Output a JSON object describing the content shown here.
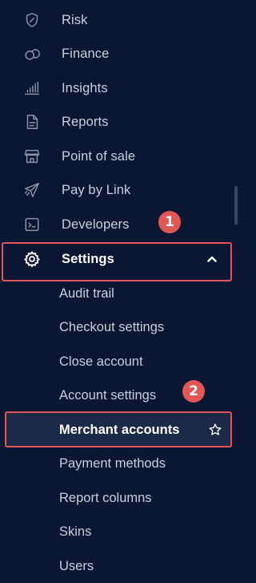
{
  "nav": {
    "items": [
      {
        "label": "Risk",
        "icon": "shield-icon"
      },
      {
        "label": "Finance",
        "icon": "coins-icon"
      },
      {
        "label": "Insights",
        "icon": "bar-chart-icon"
      },
      {
        "label": "Reports",
        "icon": "document-icon"
      },
      {
        "label": "Point of sale",
        "icon": "store-icon"
      },
      {
        "label": "Pay by Link",
        "icon": "paper-plane-icon"
      },
      {
        "label": "Developers",
        "icon": "terminal-icon"
      },
      {
        "label": "Settings",
        "icon": "gear-icon",
        "active": true,
        "expanded": true
      }
    ],
    "settings_submenu": [
      {
        "label": "Audit trail"
      },
      {
        "label": "Checkout settings"
      },
      {
        "label": "Close account"
      },
      {
        "label": "Account settings"
      },
      {
        "label": "Merchant accounts",
        "selected": true,
        "favorite_icon": "star-icon"
      },
      {
        "label": "Payment methods"
      },
      {
        "label": "Report columns"
      },
      {
        "label": "Skins"
      },
      {
        "label": "Users"
      }
    ]
  },
  "annotations": {
    "step1": "1",
    "step2": "2",
    "color": "#e25656"
  },
  "colors": {
    "background": "#0b1633",
    "selected_background": "#1c2a47",
    "text": "#c9cfdb",
    "icon": "#8b93a7",
    "active_text": "#ffffff"
  }
}
